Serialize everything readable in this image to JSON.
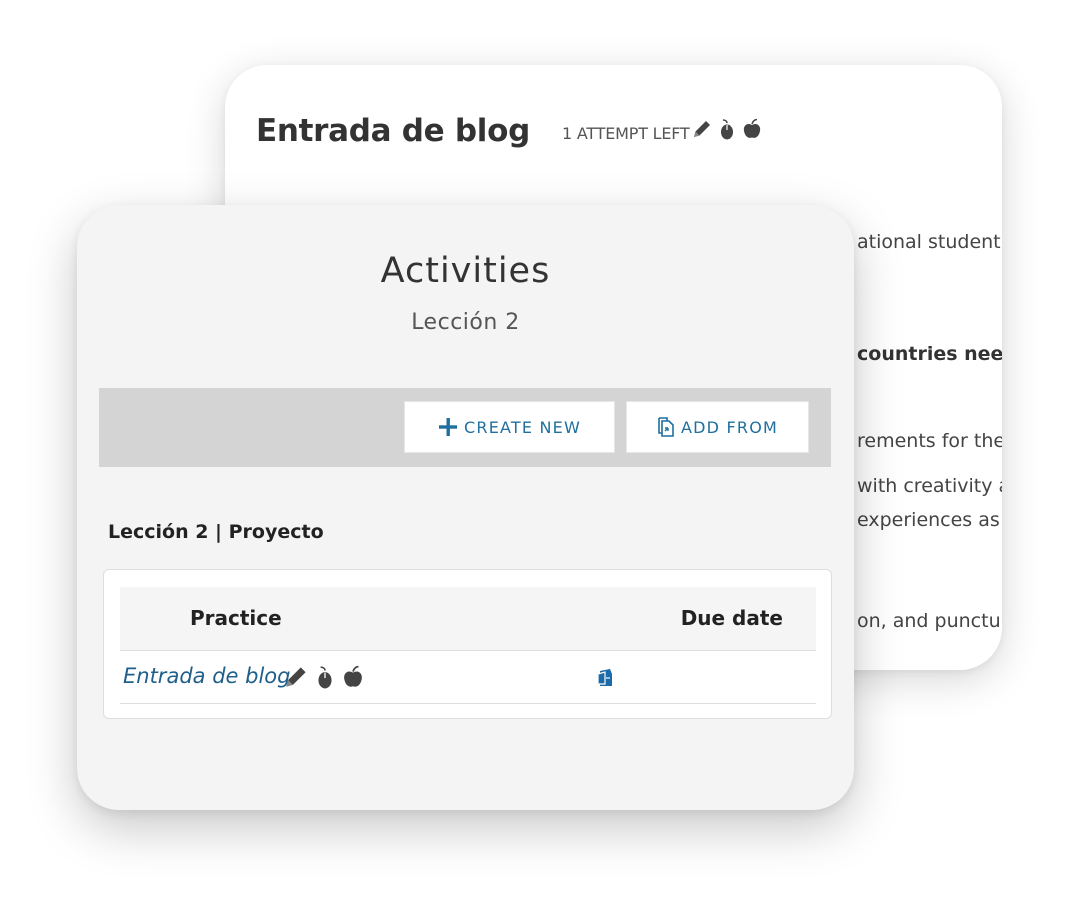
{
  "back_card": {
    "title": "Entrada de blog",
    "attempts_text": "1 ATTEMPT LEFT",
    "icons": [
      "pencil-icon",
      "mouse-icon",
      "apple-icon"
    ],
    "fragments": [
      "ational student",
      "countries nee",
      "rements for the",
      "with creativity a",
      "experiences as",
      "on, and punctu"
    ]
  },
  "front_card": {
    "title": "Activities",
    "subtitle": "Lección 2",
    "toolbar": {
      "create_new": {
        "label": "CREATE NEW",
        "icon": "plus-icon"
      },
      "add_from": {
        "label": "ADD FROM",
        "icon": "copy-document-icon"
      }
    },
    "section_heading": "Lección 2 | Proyecto",
    "table": {
      "columns": [
        "Practice",
        "Due date"
      ],
      "rows": [
        {
          "practice": "Entrada de blog",
          "icons": [
            "pencil-icon",
            "mouse-icon",
            "apple-icon"
          ],
          "due_icon": "assign-date-icon"
        }
      ]
    }
  },
  "colors": {
    "accent_blue": "#1f6f9f",
    "link_blue": "#1f5f8b",
    "toolbar_gray": "#d4d4d4",
    "card_bg": "#f4f4f4"
  }
}
